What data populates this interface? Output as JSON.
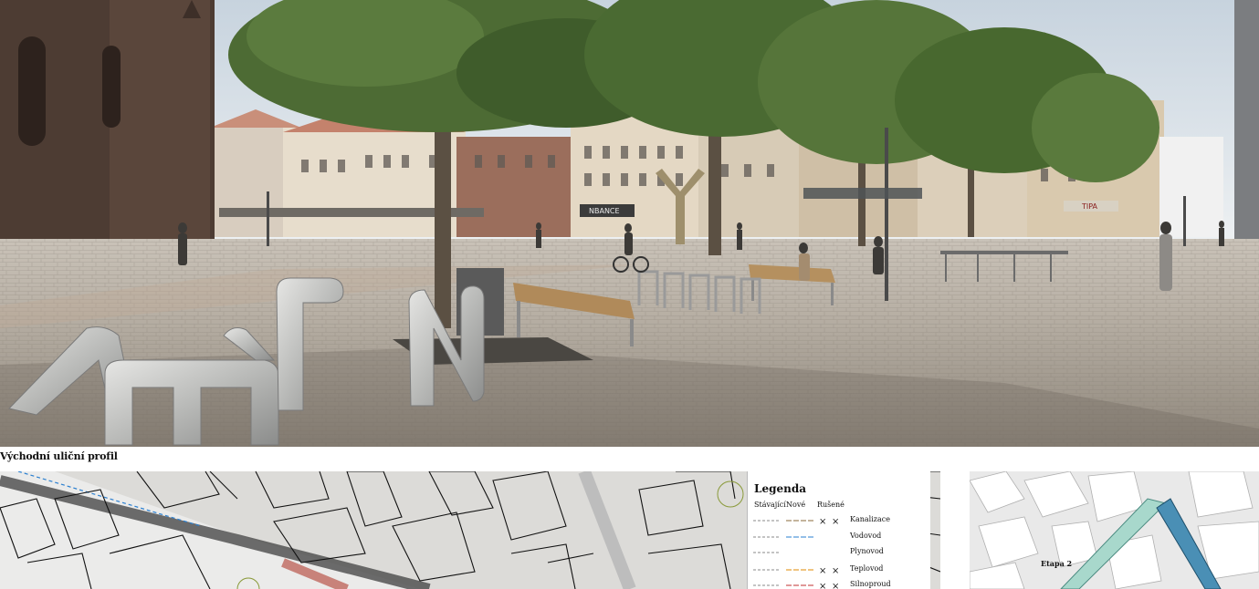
{
  "render": {
    "shop_sign_left": "NBANCE",
    "shop_sign_right": "TIPA",
    "sculpture_letters": "AMEN"
  },
  "profile": {
    "title": "Východní uliční profil"
  },
  "legend": {
    "title": "Legenda",
    "columns": [
      "Stávající",
      "Nové",
      "Rušené"
    ],
    "items": [
      {
        "label": "Kanalizace",
        "color": "#8a6a3a"
      },
      {
        "label": "Vodovod",
        "color": "#2a7fd0"
      },
      {
        "label": "Plynovod",
        "color": "#c9b400"
      },
      {
        "label": "Teplovod",
        "color": "#e08a00"
      },
      {
        "label": "Silnoproud",
        "color": "#c03030"
      }
    ]
  },
  "map": {
    "stage_label": "Etapa 2"
  }
}
